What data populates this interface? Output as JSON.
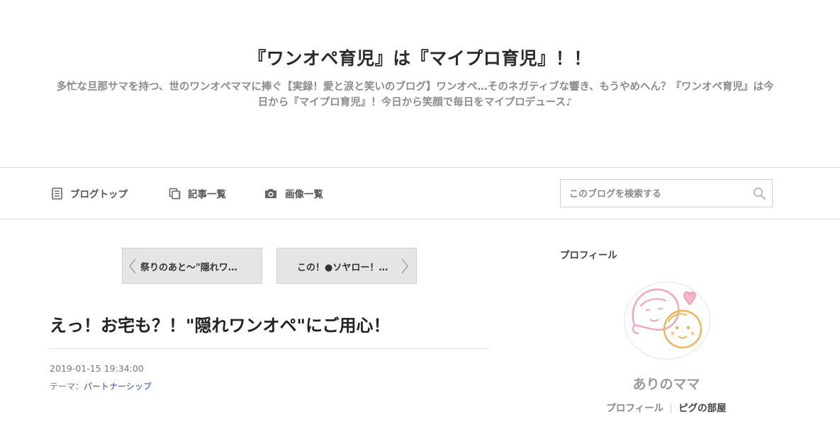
{
  "header": {
    "title": "『ワンオペ育児』は『マイプロ育児』！！",
    "description_line1": "多忙な旦那サマを持つ、世のワンオペママに捧ぐ【実録！愛と涙と笑いのブログ】ワンオペ…そのネガティブな響き、もうやめへん？『ワンオペ育児』は今",
    "description_line2": "日から『マイプロ育児』！今日から笑顔で毎日をマイプロデュース♪"
  },
  "nav": {
    "items": [
      {
        "label": "ブログトップ",
        "icon": "document-icon"
      },
      {
        "label": "記事一覧",
        "icon": "copy-icon"
      },
      {
        "label": "画像一覧",
        "icon": "camera-icon"
      }
    ],
    "search": {
      "placeholder": "このブログを検索する",
      "value": ""
    }
  },
  "pager": {
    "prev_label": "祭りのあと〜\"隠れワ…",
    "next_label": "この！●ソヤロー！…"
  },
  "article": {
    "title": "えっ！お宅も？！\"隠れワンオペ\"にご用心！",
    "date": "2019-01-15 19:34:00",
    "theme_label": "テーマ：",
    "theme_value": "パートナーシップ"
  },
  "sidebar": {
    "heading": "プロフィール",
    "name": "ありのママ",
    "links": [
      "プロフィール",
      "ピグの部屋"
    ]
  },
  "colors": {
    "accent_link": "#2a4fb0",
    "avatar_pink": "#f3a3b8",
    "avatar_orange": "#f0b455"
  }
}
